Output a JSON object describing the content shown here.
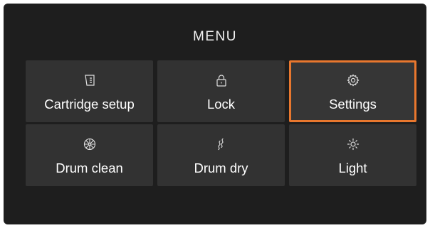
{
  "menu": {
    "title": "MENU",
    "accent_color": "#e8772e",
    "items": [
      {
        "label": "Cartridge setup",
        "icon": "cartridge-icon"
      },
      {
        "label": "Lock",
        "icon": "lock-icon"
      },
      {
        "label": "Settings",
        "icon": "gear-icon",
        "selected": true
      },
      {
        "label": "Drum clean",
        "icon": "drum-clean-icon"
      },
      {
        "label": "Drum dry",
        "icon": "drum-dry-icon"
      },
      {
        "label": "Light",
        "icon": "sun-icon"
      }
    ]
  }
}
